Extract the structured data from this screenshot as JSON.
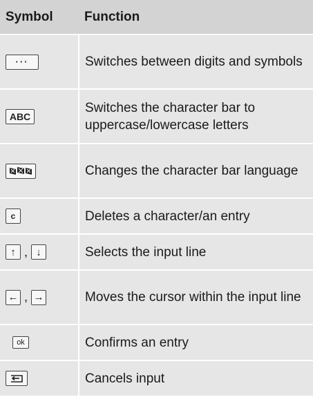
{
  "header": {
    "symbol": "Symbol",
    "function": "Function"
  },
  "rows": [
    {
      "icon": "dots-key-icon",
      "symbol_text": "···",
      "function": "Switches between digits and symbols"
    },
    {
      "icon": "abc-key-icon",
      "symbol_text": "ABC",
      "function": "Switches the character bar to uppercase/lowercase letters"
    },
    {
      "icon": "flags-key-icon",
      "function": "Changes the character bar language"
    },
    {
      "icon": "c-key-icon",
      "symbol_text": "c",
      "function": "Deletes a character/an entry"
    },
    {
      "icons": [
        "arrow-up-key-icon",
        "arrow-down-key-icon"
      ],
      "symbol_text": [
        "↑",
        "↓"
      ],
      "separator": ",",
      "function": "Selects the input line"
    },
    {
      "icons": [
        "arrow-left-key-icon",
        "arrow-right-key-icon"
      ],
      "symbol_text": [
        "←",
        "→"
      ],
      "separator": ",",
      "function": "Moves the cursor within the input line"
    },
    {
      "icon": "ok-key-icon",
      "symbol_text": "ok",
      "function": "Confirms an entry"
    },
    {
      "icon": "back-key-icon",
      "function": "Cancels input"
    }
  ]
}
